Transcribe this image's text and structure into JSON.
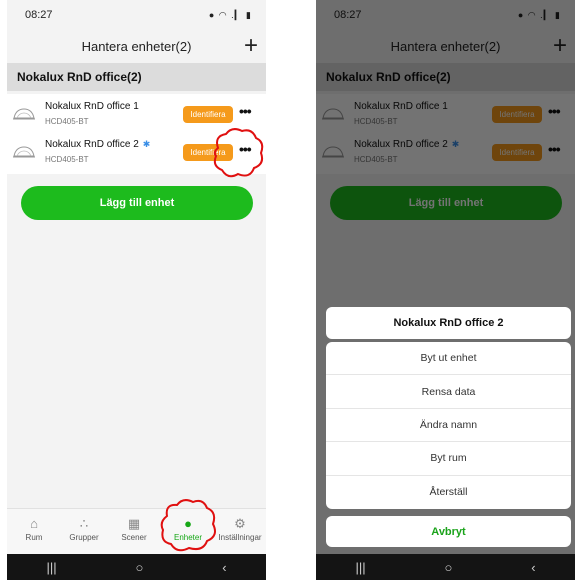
{
  "status": {
    "time": "08:27",
    "icons": "● ◠ .▎ ▮"
  },
  "header": {
    "title": "Hantera enheter(2)",
    "add_label": "+"
  },
  "group": {
    "title": "Nokalux RnD office(2)"
  },
  "devices": [
    {
      "name": "Nokalux RnD office 1",
      "model": "HCD405-BT",
      "identify": "Identifiera",
      "more": "•••",
      "bluetooth": ""
    },
    {
      "name": "Nokalux RnD office 2",
      "model": "HCD405-BT",
      "identify": "Identifiera",
      "more": "•••",
      "bluetooth": "✱"
    }
  ],
  "add_device_label": "Lägg till enhet",
  "nav": [
    {
      "label": "Rum",
      "icon": "home-icon",
      "glyph": "⌂"
    },
    {
      "label": "Grupper",
      "icon": "groups-icon",
      "glyph": "∴"
    },
    {
      "label": "Scener",
      "icon": "scenes-icon",
      "glyph": "▦"
    },
    {
      "label": "Enheter",
      "icon": "bulb-icon",
      "glyph": "●"
    },
    {
      "label": "Inställningar",
      "icon": "gear-icon",
      "glyph": "⚙"
    }
  ],
  "android_nav": {
    "recent": "|||",
    "home": "○",
    "back": "‹"
  },
  "sheet": {
    "title": "Nokalux RnD office 2",
    "items": [
      "Byt ut enhet",
      "Rensa data",
      "Ändra namn",
      "Byt rum",
      "Återställ"
    ],
    "cancel": "Avbryt"
  },
  "colors": {
    "accent_green": "#1dbb1d",
    "identify_orange": "#f59a1b",
    "callout_red": "#e01010"
  }
}
